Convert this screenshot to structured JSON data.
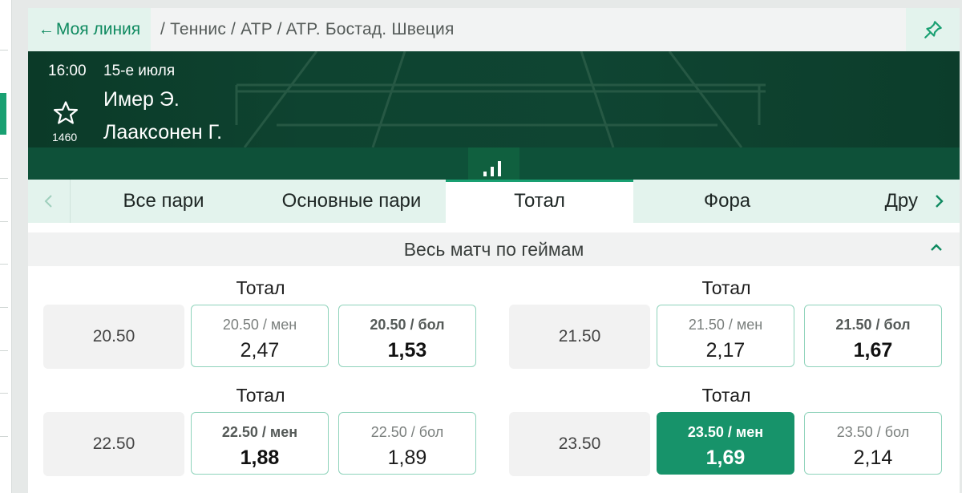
{
  "breadcrumb": {
    "back_label": "Моя линия",
    "path": "/ Теннис / ATP / ATP. Бостад. Швеция"
  },
  "event": {
    "time": "16:00",
    "date": "15-е июля",
    "team1": "Имер Э.",
    "team2": "Лааксонен Г.",
    "id": "1460"
  },
  "tabs": [
    {
      "label": "Все пари",
      "active": false
    },
    {
      "label": "Основные пари",
      "active": false
    },
    {
      "label": "Тотал",
      "active": true
    },
    {
      "label": "Фора",
      "active": false
    },
    {
      "label": "Дру",
      "active": false
    }
  ],
  "section": {
    "title": "Весь матч по геймам"
  },
  "markets": [
    {
      "title": "Тотал",
      "line": "20.50",
      "under": {
        "label": "20.50 / мен",
        "odds": "2,47"
      },
      "over": {
        "label": "20.50 / бол",
        "odds": "1,53"
      }
    },
    {
      "title": "Тотал",
      "line": "21.50",
      "under": {
        "label": "21.50 / мен",
        "odds": "2,17"
      },
      "over": {
        "label": "21.50 / бол",
        "odds": "1,67"
      }
    },
    {
      "title": "Тотал",
      "line": "22.50",
      "under": {
        "label": "22.50 / мен",
        "odds": "1,88"
      },
      "over": {
        "label": "22.50 / бол",
        "odds": "1,89"
      }
    },
    {
      "title": "Тотал",
      "line": "23.50",
      "under": {
        "label": "23.50 / мен",
        "odds": "1,69"
      },
      "over": {
        "label": "23.50 / бол",
        "odds": "2,14"
      }
    }
  ],
  "colors": {
    "accent": "#19a072",
    "header_bg": "#0e4330",
    "selected": "#17936a"
  },
  "icons": {
    "back": "arrow-left-icon",
    "pin": "pin-icon",
    "favorite": "star-icon",
    "stats": "bar-chart-icon",
    "tab_prev": "chevron-left-icon",
    "tab_next": "chevron-right-icon",
    "collapse": "chevron-up-icon"
  }
}
